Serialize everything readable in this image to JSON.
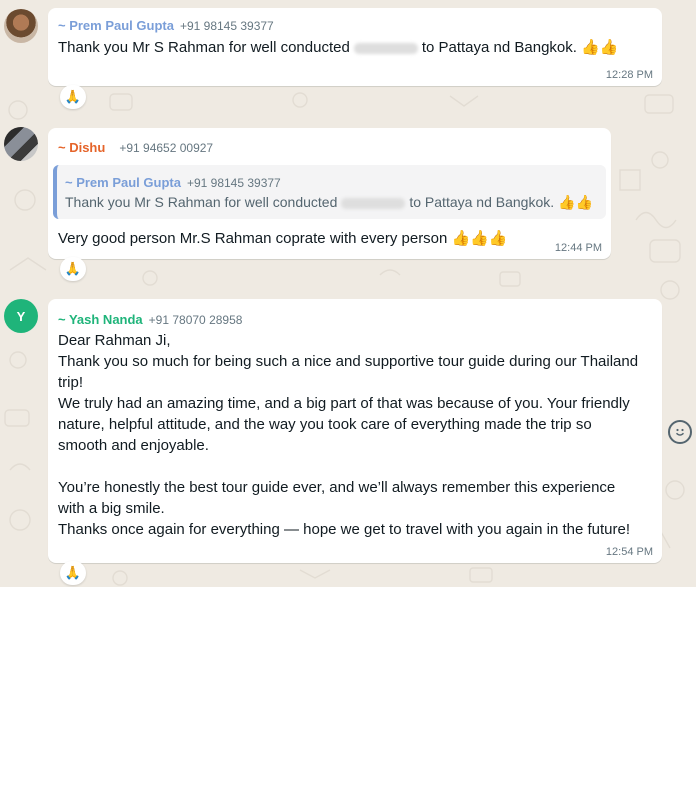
{
  "messages": [
    {
      "sender": "~ Prem Paul Gupta",
      "phone": "+91 98145 39377",
      "text_before": "Thank you Mr S Rahman for  well conducted",
      "text_after": "to Pattaya nd Bangkok.",
      "emoji": "👍👍",
      "time": "12:28 PM",
      "reaction": "🙏",
      "colors": {
        "sender": "#7a9ed8"
      }
    },
    {
      "sender": "~ Dishu",
      "phone": "+91 94652 00927",
      "quote": {
        "sender": "~ Prem Paul Gupta",
        "phone": "+91 98145 39377",
        "text_before": "Thank you Mr S Rahman for  well conducted",
        "text_after": "to Pattaya nd Bangkok.",
        "emoji": "👍👍"
      },
      "text": "Very good person Mr.S Rahman coprate with every person",
      "emoji": "👍👍👍",
      "time": "12:44 PM",
      "reaction": "🙏",
      "colors": {
        "sender": "#e5642a"
      }
    },
    {
      "avatar_letter": "Y",
      "sender": "~ Yash Nanda",
      "phone": "+91 78070 28958",
      "lines": [
        "Dear Rahman Ji,",
        "Thank you so much for being such a nice and supportive tour guide during our Thailand",
        "trip!",
        "We truly had an amazing time, and a big part of that was because of you. Your friendly",
        "nature, helpful attitude, and the way you took care of everything made the trip so",
        "smooth and enjoyable.",
        "",
        "You’re honestly the best tour guide ever, and we’ll always remember this experience",
        "with a big smile.",
        "Thanks once again for everything — hope we get to travel with you again in the future!"
      ],
      "time": "12:54 PM",
      "reaction": "🙏",
      "colors": {
        "sender": "#1fb47a"
      }
    }
  ],
  "side_icon": "smiley-icon"
}
